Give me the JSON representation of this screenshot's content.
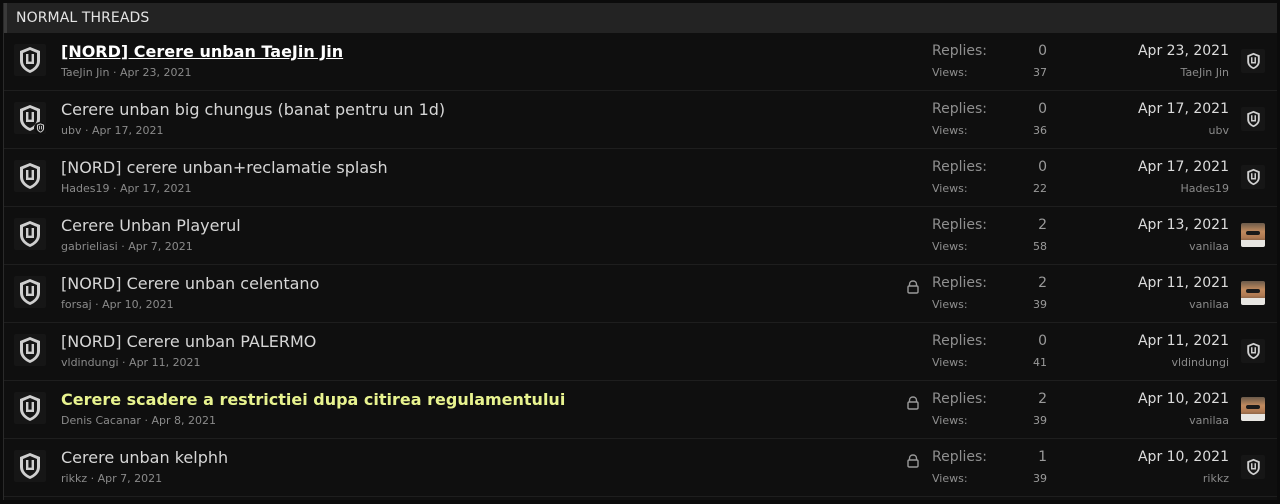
{
  "section_title": "NORMAL THREADS",
  "labels": {
    "replies": "Replies:",
    "views": "Views:"
  },
  "threads": [
    {
      "title": "[NORD] Cerere unban TaeJin Jin",
      "author": "TaeJin Jin",
      "date": "Apr 23, 2021",
      "replies": "0",
      "views": "37",
      "last_date": "Apr 23, 2021",
      "last_user": "TaeJin Jin"
    },
    {
      "title": "Cerere unban big chungus (banat pentru un 1d)",
      "author": "ubv",
      "date": "Apr 17, 2021",
      "replies": "0",
      "views": "36",
      "last_date": "Apr 17, 2021",
      "last_user": "ubv"
    },
    {
      "title": "[NORD] cerere unban+reclamatie splash",
      "author": "Hades19",
      "date": "Apr 17, 2021",
      "replies": "0",
      "views": "22",
      "last_date": "Apr 17, 2021",
      "last_user": "Hades19"
    },
    {
      "title": "Cerere Unban Playerul",
      "author": "gabrieliasi",
      "date": "Apr 7, 2021",
      "replies": "2",
      "views": "58",
      "last_date": "Apr 13, 2021",
      "last_user": "vanilaa"
    },
    {
      "title": "[NORD] Cerere unban celentano",
      "author": "forsaj",
      "date": "Apr 10, 2021",
      "replies": "2",
      "views": "39",
      "last_date": "Apr 11, 2021",
      "last_user": "vanilaa"
    },
    {
      "title": "[NORD] Cerere unban PALERMO",
      "author": "vldindungi",
      "date": "Apr 11, 2021",
      "replies": "0",
      "views": "41",
      "last_date": "Apr 11, 2021",
      "last_user": "vldindungi"
    },
    {
      "title": "Cerere scadere a restrictiei dupa citirea regulamentului",
      "author": "Denis Cacanar",
      "date": "Apr 8, 2021",
      "replies": "2",
      "views": "39",
      "last_date": "Apr 10, 2021",
      "last_user": "vanilaa"
    },
    {
      "title": "Cerere unban kelphh",
      "author": "rikkz",
      "date": "Apr 7, 2021",
      "replies": "1",
      "views": "39",
      "last_date": "Apr 10, 2021",
      "last_user": "rikkz"
    }
  ],
  "meta_separator": " · "
}
